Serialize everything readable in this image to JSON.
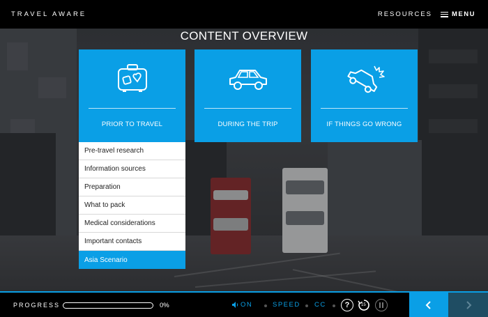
{
  "header": {
    "brand": "TRAVEL AWARE",
    "resources_label": "RESOURCES",
    "menu_label": "MENU"
  },
  "page_title": "CONTENT OVERVIEW",
  "cards": [
    {
      "label": "PRIOR TO TRAVEL",
      "icon": "suitcase-icon"
    },
    {
      "label": "DURING THE TRIP",
      "icon": "car-icon"
    },
    {
      "label": "IF THINGS GO WRONG",
      "icon": "car-crash-icon"
    }
  ],
  "submenu": {
    "items": [
      "Pre-travel research",
      "Information sources",
      "Preparation",
      "What to pack",
      "Medical considerations",
      "Important contacts",
      "Asia Scenario"
    ],
    "active_index": 6
  },
  "footer": {
    "progress_label": "PROGRESS",
    "progress_value": 0,
    "progress_text": "0%",
    "audio_label": "ON",
    "speed_label": "SPEED",
    "cc_label": "CC",
    "replay_seconds": "15"
  },
  "colors": {
    "accent": "#0a9fe6",
    "header_bg": "#000000",
    "next_disabled": "#1f4d63"
  }
}
